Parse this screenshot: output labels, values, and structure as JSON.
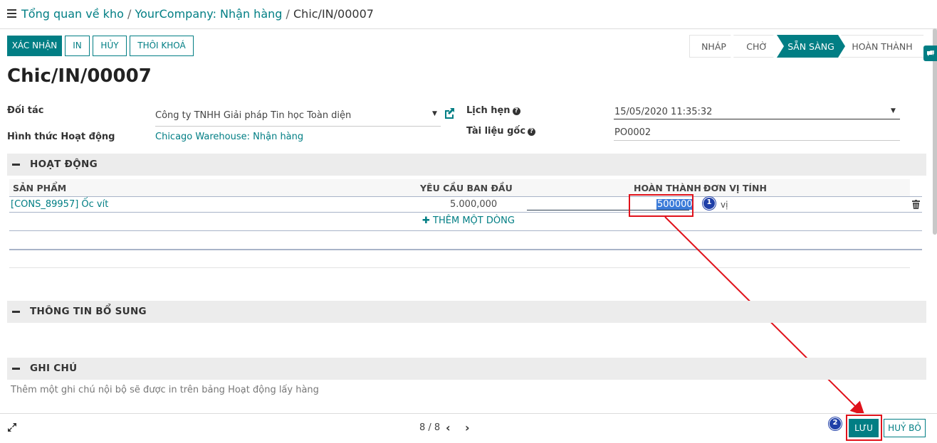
{
  "breadcrumb": {
    "items": [
      "Tổng quan về kho",
      "YourCompany: Nhận hàng"
    ],
    "separator": "/",
    "current": "Chic/IN/00007"
  },
  "actions": {
    "confirm": "XÁC NHẬN",
    "print": "IN",
    "cancel": "HỦY",
    "unreserve": "THÔI KHOÁ"
  },
  "status": {
    "steps": [
      "NHÁP",
      "CHỜ",
      "SẴN SÀNG",
      "HOÀN THÀNH"
    ],
    "active": "SẴN SÀNG"
  },
  "record": {
    "title": "Chic/IN/00007",
    "partner_label": "Đối tác",
    "partner_value": "Công ty TNHH Giải pháp Tin học Toàn diện",
    "operation_type_label": "Hình thức Hoạt động",
    "operation_type_value": "Chicago Warehouse: Nhận hàng",
    "scheduled_label": "Lịch hẹn",
    "scheduled_value": "15/05/2020 11:35:32",
    "source_label": "Tài liệu gốc",
    "source_value": "PO0002",
    "help_glyph": "?"
  },
  "operations": {
    "section_title": "HOẠT ĐỘNG",
    "columns": {
      "product": "SẢN PHẨM",
      "initial_demand": "YÊU CẦU BAN ĐẦU",
      "done": "HOÀN THÀNH",
      "uom": "ĐƠN VỊ TÍNH"
    },
    "rows": [
      {
        "product": "[CONS_89957] Ốc vít",
        "initial_demand": "5.000,000",
        "done": "500000",
        "uom": "vị"
      }
    ],
    "add_line": "THÊM MỘT DÒNG"
  },
  "additional_info": {
    "section_title": "THÔNG TIN BỔ SUNG"
  },
  "notes": {
    "section_title": "GHI CHÚ",
    "placeholder": "Thêm một ghi chú nội bộ sẽ được in trên bảng Hoạt động lấy hàng"
  },
  "footer": {
    "pager": "8 / 8",
    "save": "LƯU",
    "discard": "HUỶ BỎ"
  },
  "annotations": {
    "step1": "1",
    "step2": "2"
  },
  "colors": {
    "accent": "#017e84",
    "annotation": "#e0121b",
    "badge": "#1f3fa8"
  }
}
